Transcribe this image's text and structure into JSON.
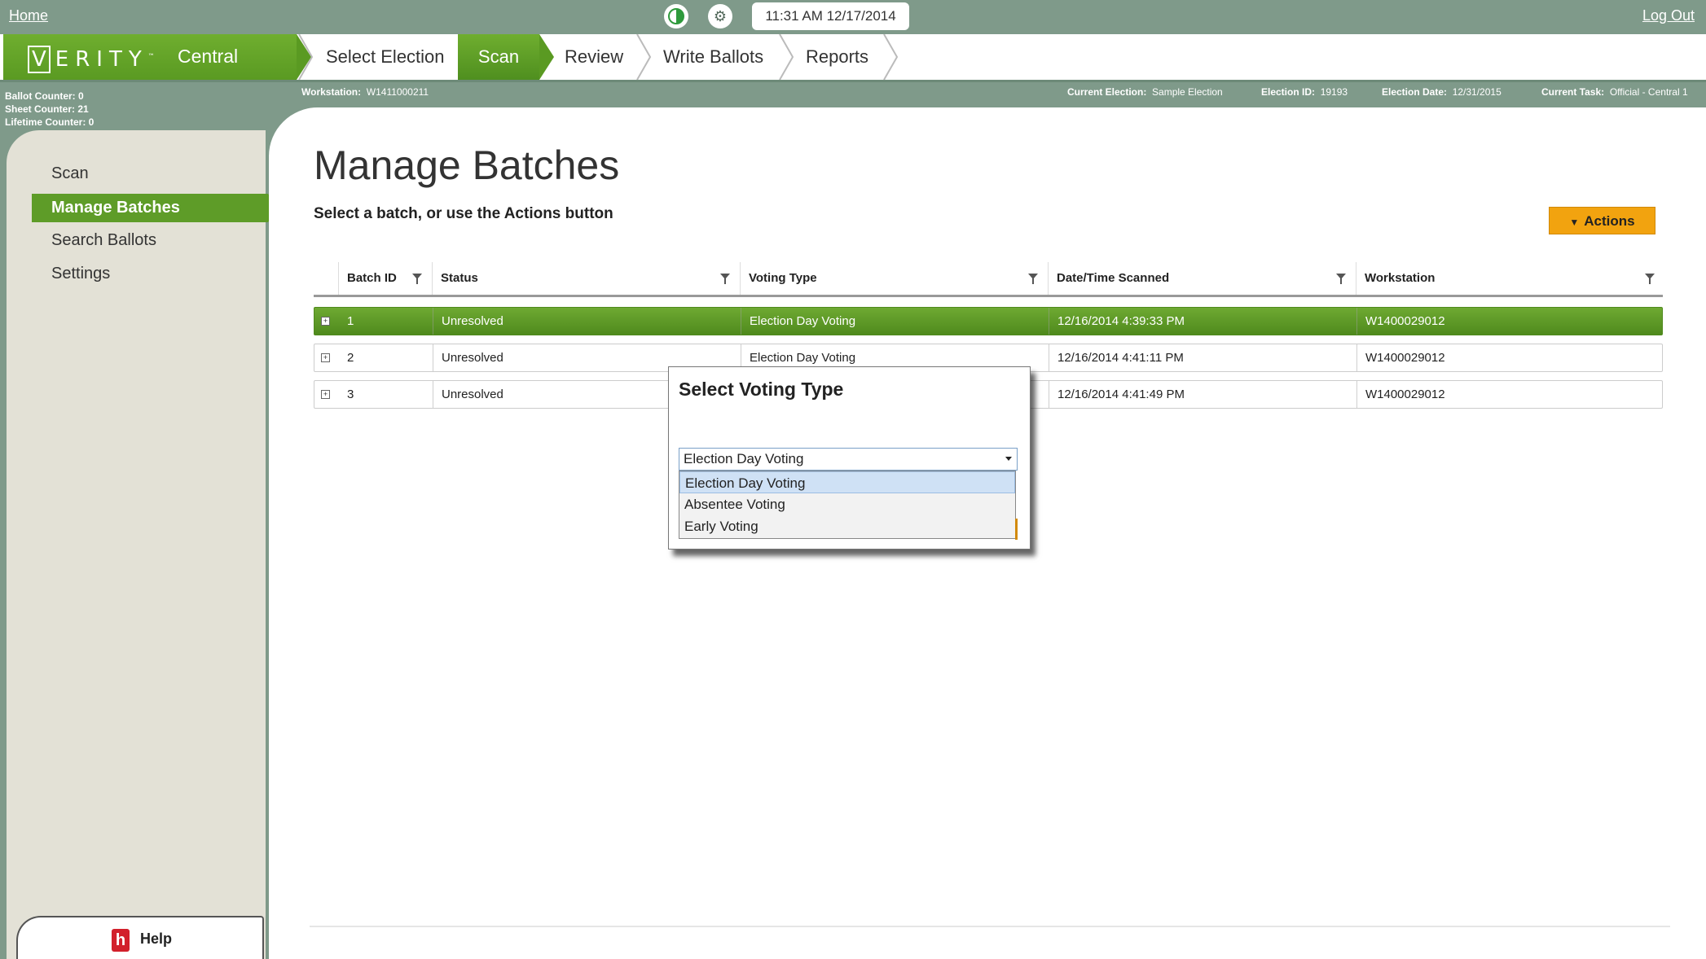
{
  "topbar": {
    "home": "Home",
    "logout": "Log Out",
    "clock": "11:31 AM 12/17/2014",
    "icons": [
      "connection-status-icon",
      "usb-icon"
    ]
  },
  "brand": {
    "logo": "VERITY",
    "logo_first": "V",
    "logo_rest": "ERITY",
    "tm": "™",
    "product": "Central"
  },
  "nav": {
    "tabs": [
      {
        "label": "Select Election"
      },
      {
        "label": "Scan",
        "active": true
      },
      {
        "label": "Review"
      },
      {
        "label": "Write Ballots"
      },
      {
        "label": "Reports"
      }
    ]
  },
  "counters": {
    "ballot": "Ballot Counter: 0",
    "sheet": "Sheet Counter: 21",
    "lifetime": "Lifetime Counter: 0"
  },
  "info": {
    "workstation_label": "Workstation:",
    "workstation_value": "W1411000211",
    "election_label": "Current Election:",
    "election_value": "Sample Election",
    "election_id_label": "Election ID:",
    "election_id_value": "19193",
    "election_date_label": "Election Date:",
    "election_date_value": "12/31/2015",
    "task_label": "Current Task:",
    "task_value": "Official - Central 1"
  },
  "sidebar": {
    "items": [
      {
        "label": "Scan"
      },
      {
        "label": "Manage Batches",
        "active": true
      },
      {
        "label": "Search Ballots"
      },
      {
        "label": "Settings"
      }
    ],
    "help": "Help",
    "help_glyph": "h"
  },
  "main": {
    "title": "Manage Batches",
    "subtitle": "Select a batch, or use the Actions button",
    "actions": "Actions"
  },
  "grid": {
    "columns": [
      "Batch ID",
      "Status",
      "Voting Type",
      "Date/Time Scanned",
      "Workstation"
    ],
    "rows": [
      {
        "batch_id": "1",
        "status": "Unresolved",
        "voting_type": "Election Day Voting",
        "scanned": "12/16/2014 4:39:33 PM",
        "workstation": "W1400029012",
        "selected": true
      },
      {
        "batch_id": "2",
        "status": "Unresolved",
        "voting_type": "Election Day Voting",
        "scanned": "12/16/2014 4:41:11 PM",
        "workstation": "W1400029012"
      },
      {
        "batch_id": "3",
        "status": "Unresolved",
        "voting_type": "",
        "scanned": "12/16/2014 4:41:49 PM",
        "workstation": "W1400029012"
      }
    ]
  },
  "modal": {
    "title": "Select Voting Type",
    "selected": "Election Day Voting",
    "options": [
      "Election Day Voting",
      "Absentee Voting",
      "Early Voting"
    ]
  },
  "colors": {
    "chrome": "#7f9a8a",
    "accent_green": "#5e9c28",
    "actions_orange": "#f2a30f"
  }
}
